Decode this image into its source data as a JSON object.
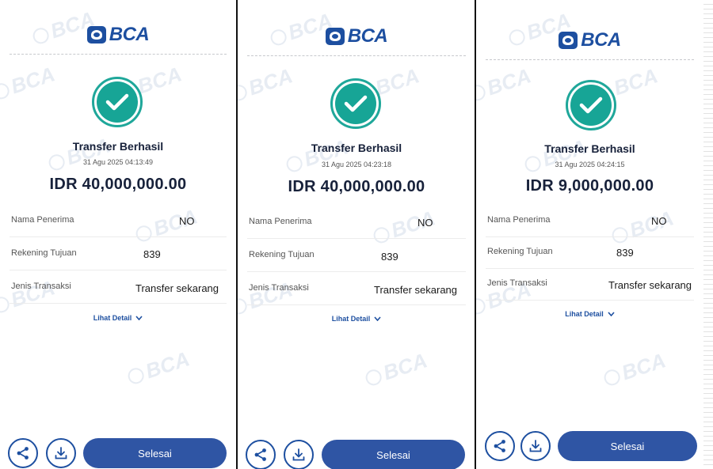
{
  "watermark": "BCA",
  "screens": [
    {
      "logo": "BCA",
      "status_title": "Transfer Berhasil",
      "timestamp": "31 Agu 2025 04:13:49",
      "amount": "IDR 40,000,000.00",
      "rows": [
        {
          "label": "Nama Penerima",
          "value": "NO"
        },
        {
          "label": "Rekening Tujuan",
          "value": "839"
        },
        {
          "label": "Jenis Transaksi",
          "value": "Transfer sekarang"
        }
      ],
      "detail_link": "Lihat Detail",
      "primary_button": "Selesai",
      "share_icon": "share-icon",
      "download_icon": "download-icon"
    },
    {
      "logo": "BCA",
      "status_title": "Transfer Berhasil",
      "timestamp": "31 Agu 2025 04:23:18",
      "amount": "IDR 40,000,000.00",
      "rows": [
        {
          "label": "Nama Penerima",
          "value": "NO"
        },
        {
          "label": "Rekening Tujuan",
          "value": "839"
        },
        {
          "label": "Jenis Transaksi",
          "value": "Transfer sekarang"
        }
      ],
      "detail_link": "Lihat Detail",
      "primary_button": "Selesai",
      "share_icon": "share-icon",
      "download_icon": "download-icon"
    },
    {
      "logo": "BCA",
      "status_title": "Transfer Berhasil",
      "timestamp": "31 Agu 2025 04:24:15",
      "amount": "IDR 9,000,000.00",
      "rows": [
        {
          "label": "Nama Penerima",
          "value": "NO"
        },
        {
          "label": "Rekening Tujuan",
          "value": "839"
        },
        {
          "label": "Jenis Transaksi",
          "value": "Transfer sekarang"
        }
      ],
      "detail_link": "Lihat Detail",
      "primary_button": "Selesai",
      "share_icon": "share-icon",
      "download_icon": "download-icon"
    }
  ],
  "colors": {
    "brand_blue": "#1d4fa0",
    "button_blue": "#2f55a4",
    "success_teal": "#17a596",
    "watermark": "#dfe6ef"
  }
}
